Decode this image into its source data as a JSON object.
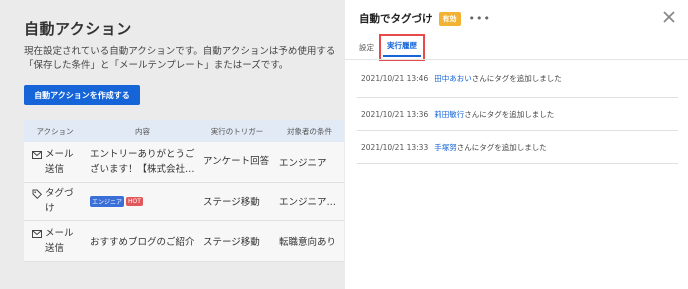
{
  "left": {
    "title": "自動アクション",
    "desc": "現在設定されている自動アクションです。自動アクションは予め使用する「保存した条件」と「メールテンプレート」またはーズです。",
    "create_button": "自動アクションを作成する",
    "columns": [
      "アクション",
      "内容",
      "実行のトリガー",
      "対象者の条件"
    ],
    "rows": [
      {
        "action": "メール送信",
        "action_icon": "mail-icon",
        "content": "エントリーありがとうございます！【株式会社…",
        "trigger": "アンケート回答",
        "condition": "エンジニア"
      },
      {
        "action": "タグづけ",
        "action_icon": "tag-icon",
        "badges": [
          "エンジニア",
          "HOT"
        ],
        "trigger": "ステージ移動",
        "condition": "エンジニア…"
      },
      {
        "action": "メール送信",
        "action_icon": "mail-icon",
        "content": "おすすめブログのご紹介",
        "trigger": "ステージ移動",
        "condition": "転職意向あり"
      }
    ]
  },
  "drawer": {
    "title": "自動でタグづけ",
    "status": "有効",
    "more": "•••",
    "tabs": {
      "settings": "設定",
      "history": "実行履歴"
    },
    "history": [
      {
        "time": "2021/10/21 13:46",
        "user": "田中あおい",
        "text": "さんにタグを追加しました"
      },
      {
        "time": "2021/10/21 13:36",
        "user": "莉田敏行",
        "text": "さんにタグを追加しました"
      },
      {
        "time": "2021/10/21 13:33",
        "user": "手塚努",
        "text": "さんにタグを追加しました"
      }
    ]
  },
  "colors": {
    "accent": "#1565d8",
    "status": "#f2b233",
    "highlight": "#e64a4a"
  }
}
